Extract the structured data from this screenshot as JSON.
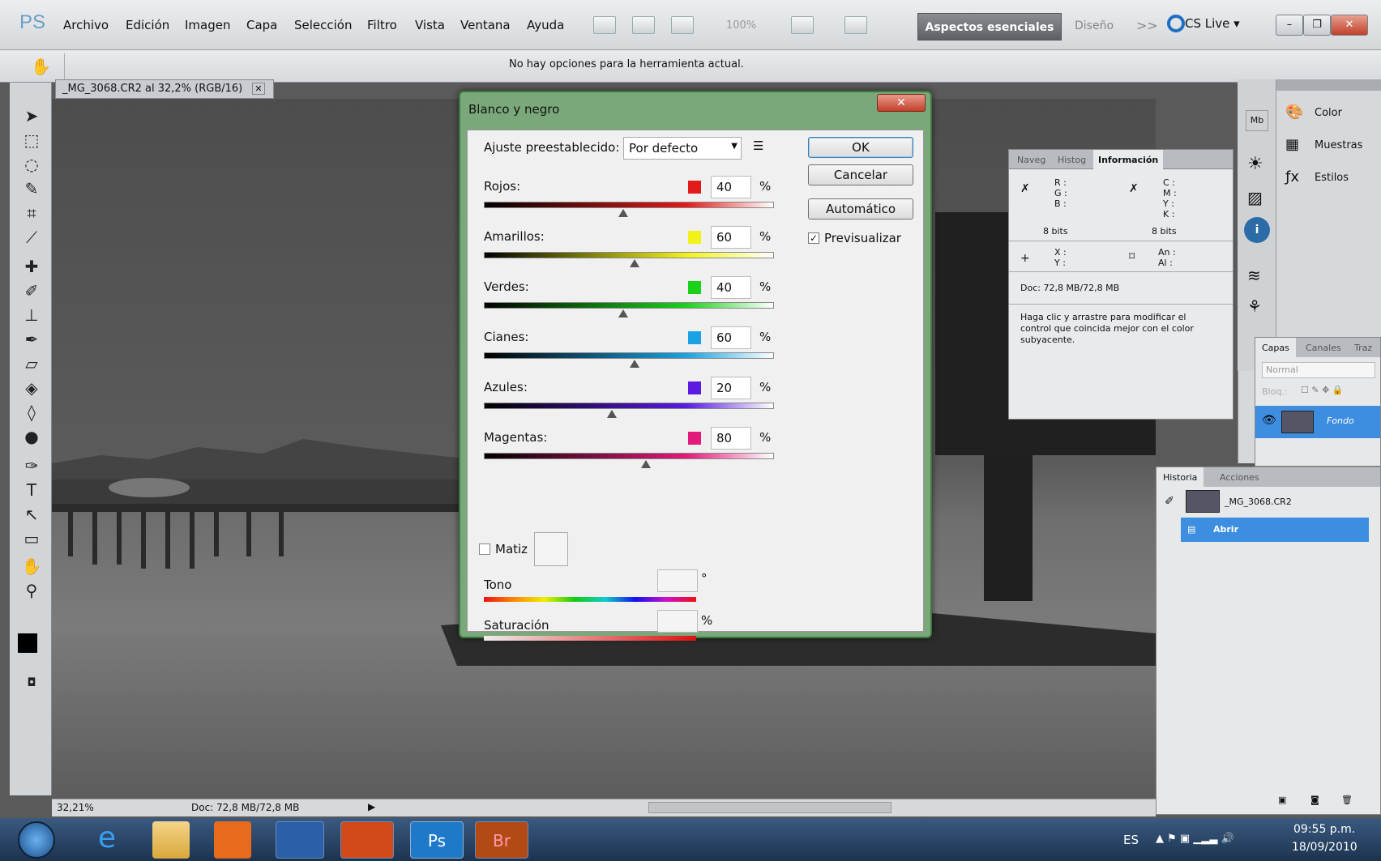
{
  "app": {
    "logo": "PS"
  },
  "menubar": {
    "items": [
      "Archivo",
      "Edición",
      "Imagen",
      "Capa",
      "Selección",
      "Filtro",
      "Vista",
      "Ventana",
      "Ayuda"
    ],
    "zoom": "100%",
    "workspace_active": "Aspectos esenciales",
    "workspace_other": "Diseño",
    "more": ">>",
    "cslive": "CS Live ▾"
  },
  "optionsbar": {
    "message": "No hay opciones para la herramienta actual."
  },
  "document": {
    "tab_title": "_MG_3068.CR2 al 32,2% (RGB/16)",
    "zoom": "32,21%",
    "doc_size": "Doc: 72,8 MB/72,8 MB"
  },
  "dialog": {
    "title": "Blanco y negro",
    "preset_label": "Ajuste preestablecido:",
    "preset_value": "Por defecto",
    "ok": "OK",
    "cancel": "Cancelar",
    "auto": "Automático",
    "preview": "Previsualizar",
    "pct": "%",
    "channels": [
      {
        "label": "Rojos:",
        "value": "40",
        "color": "#e21a1a"
      },
      {
        "label": "Amarillos:",
        "value": "60",
        "color": "#f2f21a"
      },
      {
        "label": "Verdes:",
        "value": "40",
        "color": "#1ad21a"
      },
      {
        "label": "Cianes:",
        "value": "60",
        "color": "#1aa2e2"
      },
      {
        "label": "Azules:",
        "value": "20",
        "color": "#5a1ae2"
      },
      {
        "label": "Magentas:",
        "value": "80",
        "color": "#e21a7a"
      }
    ],
    "tint_label": "Matiz",
    "tone_label": "Tono",
    "tone_unit": "°",
    "saturation_label": "Saturación",
    "saturation_unit": "%"
  },
  "info_panel": {
    "tabs": [
      "Naveg",
      "Histog",
      "Información"
    ],
    "rgb": "R :\nG :\nB :",
    "cmyk": "C :\nM :\nY :\nK :",
    "bits_left": "8 bits",
    "bits_right": "8 bits",
    "xy": "X :\nY :",
    "anal": "An :\nAl :",
    "doc": "Doc: 72,8 MB/72,8 MB",
    "hint": "Haga clic y arrastre para modificar el control que coincida mejor con el color subyacente."
  },
  "dock": {
    "items": [
      "Color",
      "Muestras",
      "Estilos"
    ]
  },
  "layers": {
    "tabs": [
      "Capas",
      "Canales",
      "Traz"
    ],
    "blend": "Normal",
    "lock_label": "Bloq.:",
    "layer_name": "Fondo"
  },
  "history": {
    "tabs": [
      "Historia",
      "Acciones"
    ],
    "snapshot": "_MG_3068.CR2",
    "step": "Abrir"
  },
  "taskbar": {
    "lang": "ES",
    "time": "09:55 p.m.",
    "date": "18/09/2010"
  }
}
